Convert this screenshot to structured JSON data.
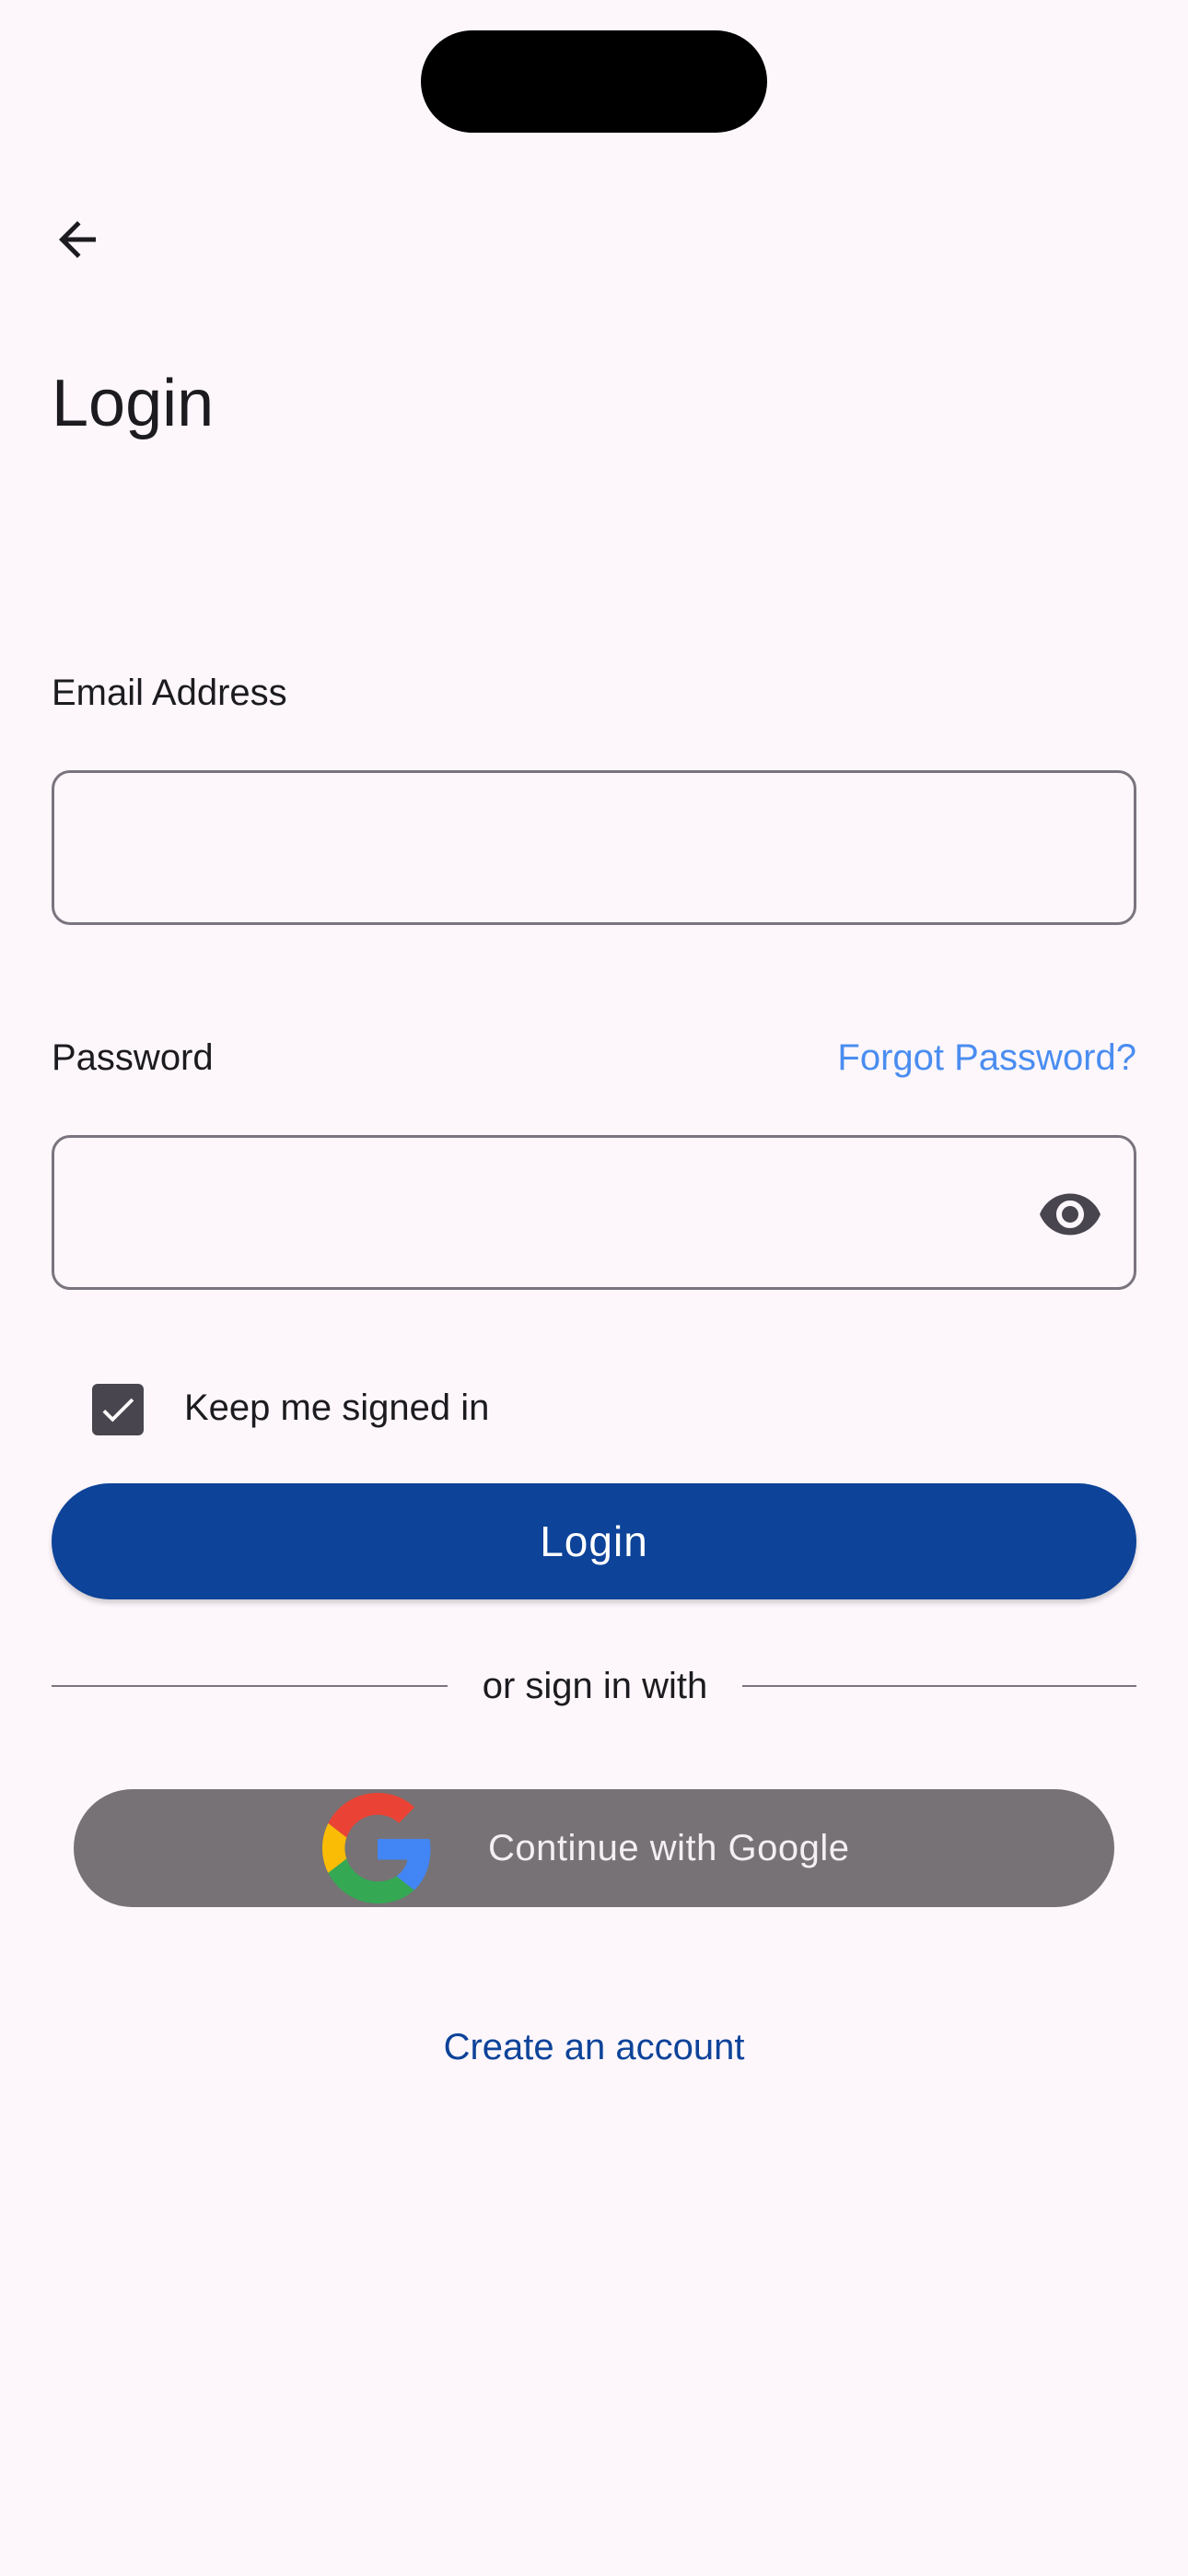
{
  "header": {
    "back_icon": "arrow-back-icon",
    "title": "Login"
  },
  "form": {
    "email": {
      "label": "Email Address",
      "value": "",
      "placeholder": ""
    },
    "password": {
      "label": "Password",
      "value": "",
      "placeholder": "",
      "forgot_link": "Forgot Password?",
      "visibility_icon": "eye-icon"
    },
    "keep_signed_in": {
      "label": "Keep me signed in",
      "checked": true
    },
    "login_button": "Login"
  },
  "divider": {
    "text": "or sign in with"
  },
  "social": {
    "google_button": "Continue with Google",
    "google_icon": "google-logo-icon"
  },
  "footer": {
    "create_account_link": "Create an account"
  },
  "colors": {
    "background": "#fdf7fc",
    "primary": "#0d4399",
    "link_light": "#4a8df0",
    "google_button_bg": "#777275",
    "checkbox": "#49454f",
    "outline": "#79747e"
  }
}
